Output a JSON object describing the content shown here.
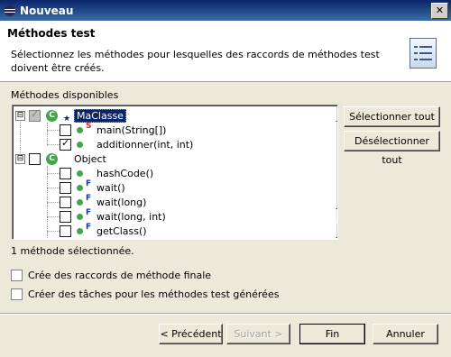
{
  "window": {
    "title": "Nouveau",
    "close_glyph": "✕"
  },
  "header": {
    "title": "Méthodes test",
    "description": "Sélectionnez les méthodes pour lesquelles des raccords de méthodes test doivent être créés."
  },
  "available_label": "Méthodes disponibles",
  "tree": {
    "items": [
      {
        "label": "MaClasse",
        "type": "class",
        "expander": "⊟",
        "checked": "partial",
        "selected": true
      },
      {
        "label": "main(String[])",
        "type": "method",
        "checked": false,
        "overlay": "S"
      },
      {
        "label": "additionner(int, int)",
        "type": "method",
        "checked": true
      },
      {
        "label": "Object",
        "type": "class",
        "expander": "⊟",
        "checked": false
      },
      {
        "label": "hashCode()",
        "type": "method",
        "checked": false
      },
      {
        "label": "wait()",
        "type": "method",
        "checked": false,
        "overlay": "F"
      },
      {
        "label": "wait(long)",
        "type": "method",
        "checked": false,
        "overlay": "F"
      },
      {
        "label": "wait(long, int)",
        "type": "method",
        "checked": false,
        "overlay": "F"
      },
      {
        "label": "getClass()",
        "type": "method",
        "checked": false,
        "overlay": "F"
      }
    ],
    "checkmark": "✓",
    "class_badge": "C",
    "star_overlay": "★"
  },
  "buttons": {
    "select_all": "Sélectionner tout",
    "deselect_all": "Désélectionner tout",
    "previous": "< Précédent",
    "next": "Suivant >",
    "finish": "Fin",
    "cancel": "Annuler"
  },
  "status": "1 méthode sélectionnée.",
  "options": {
    "final_stubs": {
      "label": "Crée des raccords de méthode finale",
      "checked": false
    },
    "create_tasks": {
      "label": "Créer des tâches pour les méthodes test générées",
      "checked": false
    }
  },
  "scrollbar": {
    "up": "▲",
    "down": "▼"
  },
  "colors": {
    "title_bar": "#0a246a",
    "selection": "#0a246a",
    "method_icon": "#3fa64a"
  }
}
